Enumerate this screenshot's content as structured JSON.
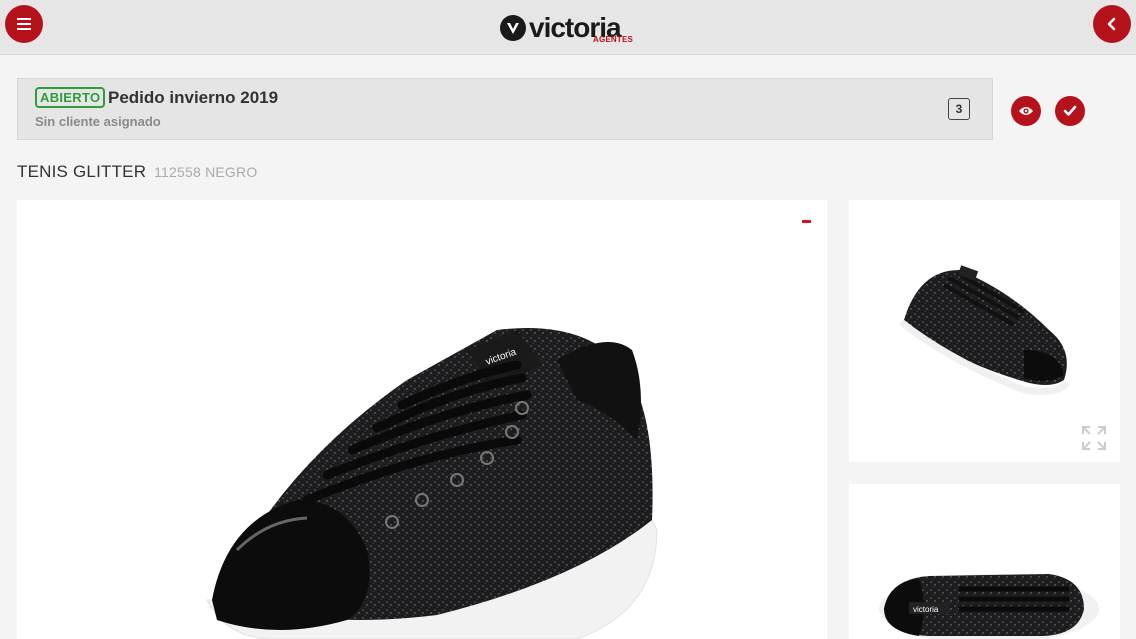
{
  "header": {
    "logo_text": "victoria",
    "logo_subtext": "AGENTES",
    "menu_icon": "hamburger-menu-icon",
    "back_icon": "chevron-left-icon",
    "brand_color": "#b5121b"
  },
  "order": {
    "status": "ABIERTO",
    "status_color": "#2e9e3a",
    "title": "Pedido invierno 2019",
    "client": "Sin cliente asignado",
    "count": "3",
    "view_icon": "eye-icon",
    "confirm_icon": "check-icon"
  },
  "product": {
    "name": "TENIS GLITTER",
    "code": "112558 NEGRO",
    "zoom_out_icon": "minus-icon",
    "expand_icon": "expand-icon"
  }
}
